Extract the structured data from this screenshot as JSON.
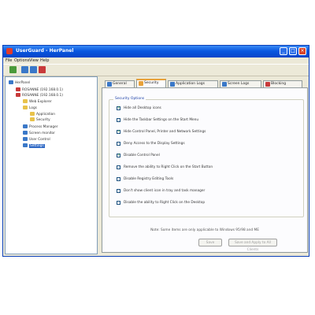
{
  "window": {
    "title": "UserGuard - HerPanel",
    "min": "_",
    "max": "□",
    "close": "×"
  },
  "menu": [
    {
      "label": "File"
    },
    {
      "label": "Options"
    },
    {
      "label": "View"
    },
    {
      "label": "Help"
    }
  ],
  "toolbar": [
    {
      "icon": "computer-icon",
      "color": "#4a9a3a"
    },
    {
      "icon": "refresh-icon",
      "color": "#3a78c8"
    },
    {
      "icon": "network-icon",
      "color": "#3a78c8"
    },
    {
      "icon": "flag-icon",
      "color": "#c83a3a"
    }
  ],
  "tree": [
    {
      "label": "HerPanel",
      "indent": 0,
      "color": "#3a78c8"
    },
    {
      "label": "ROSANNE (192.168.0.1)",
      "indent": 1,
      "color": "#c83a3a"
    },
    {
      "label": "ROSANNE (192.168.0.1)",
      "indent": 1,
      "color": "#c83a3a"
    },
    {
      "label": "Web Explorer",
      "indent": 2,
      "color": "#e8c24a"
    },
    {
      "label": "Logs",
      "indent": 2,
      "color": "#e8c24a"
    },
    {
      "label": "Application",
      "indent": 3,
      "color": "#e8c24a"
    },
    {
      "label": "Security",
      "indent": 3,
      "color": "#e8c24a"
    },
    {
      "label": "Process Manager",
      "indent": 2,
      "color": "#3a78c8"
    },
    {
      "label": "Screen monitor",
      "indent": 2,
      "color": "#3a78c8"
    },
    {
      "label": "User Control",
      "indent": 2,
      "color": "#3a78c8"
    },
    {
      "label": "Settings",
      "indent": 2,
      "color": "#3a78c8",
      "selected": true
    }
  ],
  "tabs": [
    {
      "label": "General",
      "color": "#3a78c8"
    },
    {
      "label": "Security",
      "color": "#e8a23a",
      "active": true
    },
    {
      "label": "Application Logs",
      "color": "#3a78c8"
    },
    {
      "label": "Screen Logs",
      "color": "#3a78c8"
    },
    {
      "label": "Blocking",
      "color": "#c83a3a"
    }
  ],
  "security": {
    "group_title": "Security Options",
    "options": [
      {
        "label": "Hide all Desktop icons",
        "checked": true
      },
      {
        "label": "Hide the Taskbar Settings on the Start Menu",
        "checked": false
      },
      {
        "label": "Hide Control Panel, Printer and Network Settings",
        "checked": true
      },
      {
        "label": "Deny Access to the Display Settings",
        "checked": false
      },
      {
        "label": "Disable Control Panel",
        "checked": true
      },
      {
        "label": "Remove the ability to Right Click on the Start Button",
        "checked": false
      },
      {
        "label": "Disable Registry Editing Tools",
        "checked": false
      },
      {
        "label": "Don't show client icon in tray and task manager",
        "checked": false
      },
      {
        "label": "Disable the ability to Right Click on the Desktop",
        "checked": false
      }
    ],
    "note": "Note: Some items are only applicable to Windows 95/98 and ME",
    "save_label": "Save",
    "save_all_label": "Save and Apply to All Clients"
  }
}
